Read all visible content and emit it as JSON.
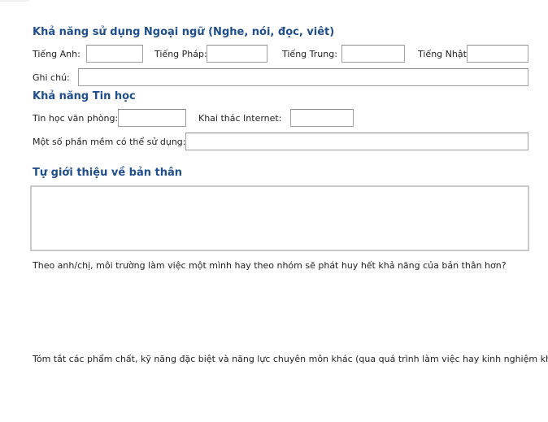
{
  "foreign_language": {
    "title": "Khả năng sử dụng Ngoại ngữ (Nghe, nói, đọc, viêt)",
    "english_label": "Tiếng Anh:",
    "french_label": "Tiếng Pháp:",
    "chinese_label": "Tiếng Trung:",
    "japanese_label": "Tiếng Nhật:",
    "note_label": "Ghi chú:",
    "english_value": "",
    "french_value": "",
    "chinese_value": "",
    "japanese_value": "",
    "note_value": ""
  },
  "computer_skills": {
    "title": "Khả năng Tin học",
    "office_label": "Tin học văn phòng:",
    "internet_label": "Khai thác Internet:",
    "software_label": "Một số phần mềm có thể sử dụng:",
    "office_value": "",
    "internet_value": "",
    "software_value": ""
  },
  "self_intro": {
    "title": "Tự giới thiệu về bản thân",
    "value": ""
  },
  "questions": {
    "work_style": "Theo anh/chị, môi trường làm việc một mình hay theo nhóm sẽ phát huy hết khả năng của bản thân hơn?",
    "summary": "Tóm tắt các phẩm chất, kỹ năng đặc biệt và năng lực chuyên môn khác (qua quá trình làm việc hay kinh nghiệm khác)"
  }
}
